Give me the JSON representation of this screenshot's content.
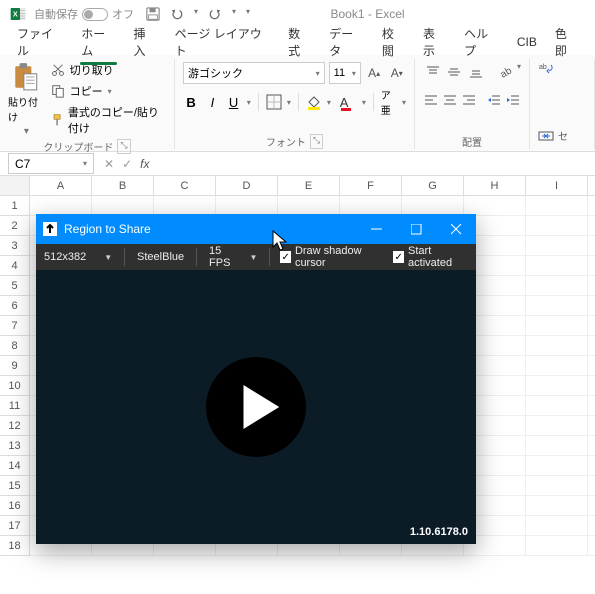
{
  "titlebar": {
    "autosave_label": "自動保存",
    "autosave_off": "オフ",
    "doc_title": "Book1 - Excel"
  },
  "tabs": [
    "ファイル",
    "ホーム",
    "挿入",
    "ページ レイアウト",
    "数式",
    "データ",
    "校閲",
    "表示",
    "ヘルプ",
    "CIB",
    "色即"
  ],
  "active_tab_index": 1,
  "clipboard": {
    "paste": "貼り付け",
    "cut": "切り取り",
    "copy": "コピー",
    "formatpainter": "書式のコピー/貼り付け",
    "group_label": "クリップボード"
  },
  "font": {
    "name": "游ゴシック",
    "size": "11",
    "group_label": "フォント",
    "bold": "B",
    "italic": "I",
    "underline": "U"
  },
  "align": {
    "group_label": "配置"
  },
  "namebox": "C7",
  "columns": [
    "A",
    "B",
    "C",
    "D",
    "E",
    "F",
    "G",
    "H",
    "I"
  ],
  "row_count": 18,
  "rts": {
    "title": "Region to Share",
    "size_dd": "512x382",
    "color_dd": "SteelBlue",
    "fps_dd": "15 FPS",
    "shadow_label": "Draw shadow cursor",
    "start_label": "Start activated",
    "version": "1.10.6178.0"
  }
}
